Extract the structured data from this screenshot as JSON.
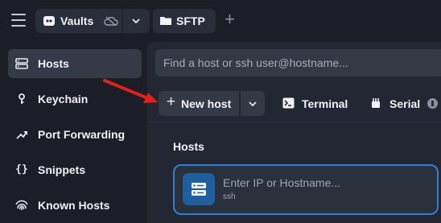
{
  "topbar": {
    "vault_label": "Vaults",
    "sftp_label": "SFTP",
    "icons": [
      "hamburger-icon",
      "vault-logo-icon",
      "cloud-off-icon",
      "chevron-down-icon",
      "folder-icon",
      "plus-icon"
    ]
  },
  "sidebar": {
    "items": [
      {
        "label": "Hosts",
        "icon": "hosts-grid-icon",
        "active": true
      },
      {
        "label": "Keychain",
        "icon": "key-icon",
        "active": false
      },
      {
        "label": "Port Forwarding",
        "icon": "port-forward-icon",
        "active": false
      },
      {
        "label": "Snippets",
        "icon": "braces-icon",
        "active": false
      },
      {
        "label": "Known Hosts",
        "icon": "fingerprint-icon",
        "active": false
      }
    ]
  },
  "main": {
    "search_placeholder": "Find a host or ssh user@hostname...",
    "new_host_label": "New host",
    "terminal_label": "Terminal",
    "serial_label": "Serial",
    "section_title": "Hosts",
    "host_card": {
      "title": "Enter IP or Hostname...",
      "subtitle": "ssh"
    }
  },
  "colors": {
    "background": "#1b1e27",
    "main_panel": "#232733",
    "accent_blue": "#2f7fd6",
    "annotation_arrow": "#e0201a"
  }
}
